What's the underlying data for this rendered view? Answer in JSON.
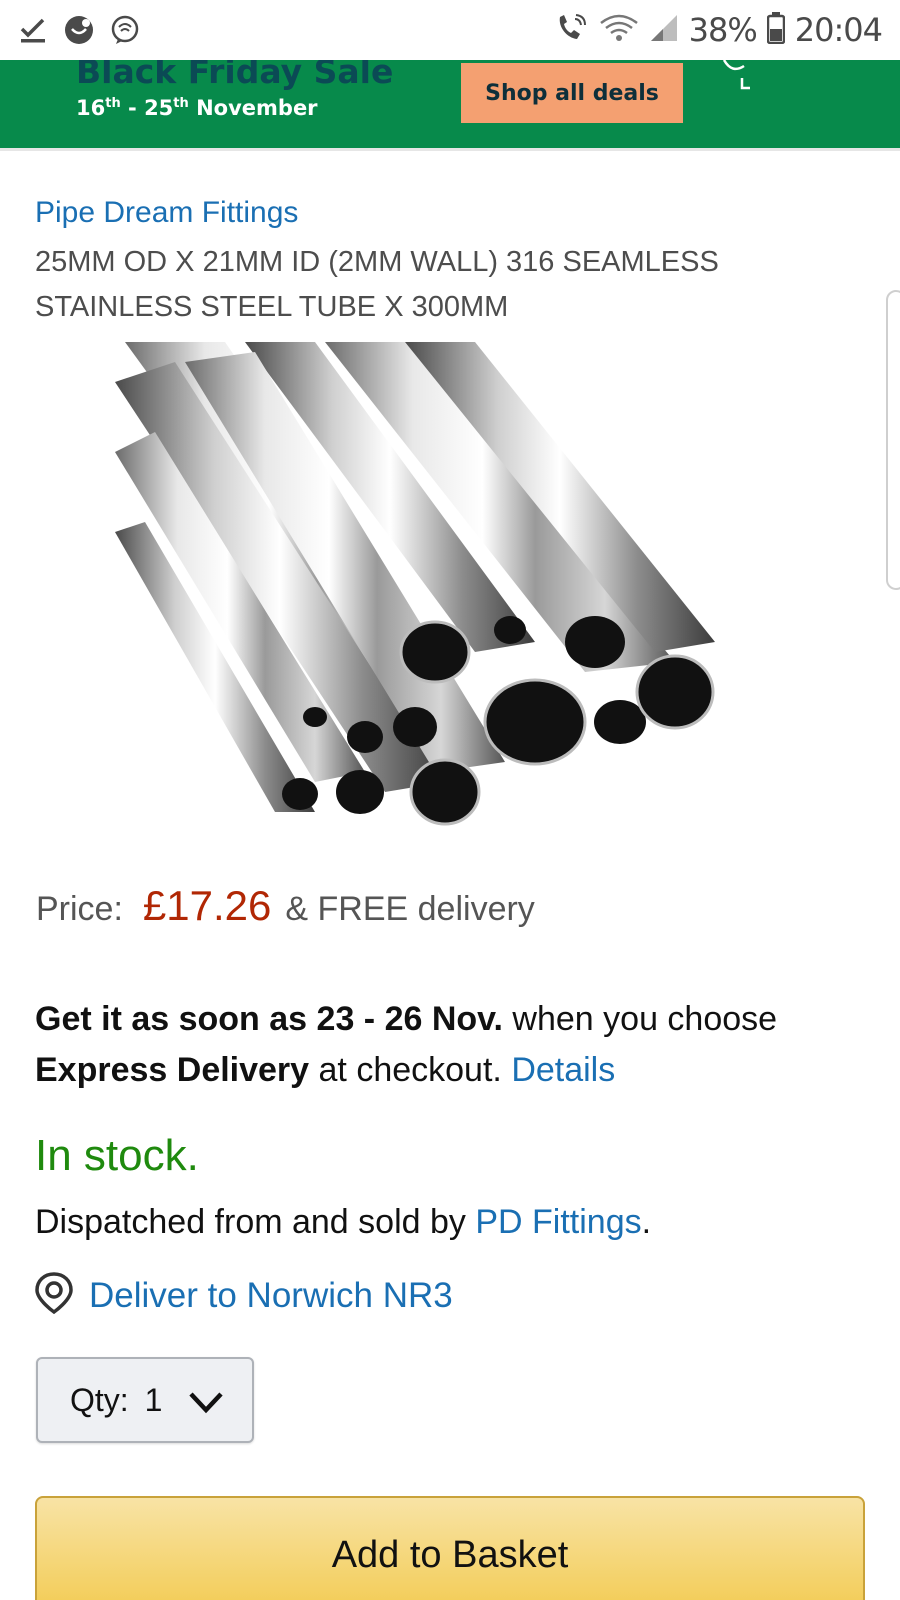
{
  "status_bar": {
    "battery": "38%",
    "time": "20:04",
    "icons": [
      "check-download-icon",
      "smiley-icon",
      "messenger-icon",
      "wifi-calling-icon",
      "wifi-icon",
      "signal-icon",
      "battery-icon"
    ]
  },
  "banner": {
    "title": "Black Friday Sale",
    "dates_start_day": "16",
    "dates_start_suffix": "th",
    "dates_sep": " - ",
    "dates_end_day": "25",
    "dates_end_suffix": "th",
    "dates_month": " November",
    "cta": "Shop all deals",
    "colors": {
      "background": "#078a4b",
      "cta": "#f4a071"
    }
  },
  "product": {
    "brand": "Pipe Dream Fittings",
    "title": "25MM OD X 21MM ID (2MM WALL) 316 SEAMLESS STAINLESS STEEL TUBE X 300MM",
    "image_alt": "stainless-steel-tubes-image",
    "price_label": "Price:",
    "price": "£17.26",
    "delivery_note": "& FREE delivery"
  },
  "delivery": {
    "bold_1": "Get it as soon as 23 - 26 Nov.",
    "text_1": " when you choose ",
    "bold_2": "Express Delivery",
    "text_2": " at checkout. ",
    "details_link": "Details"
  },
  "availability": {
    "stock": "In stock.",
    "dispatched_prefix": "Dispatched from and sold by ",
    "seller": "PD Fittings",
    "dispatched_suffix": ".",
    "deliver_to": "Deliver to Norwich NR3"
  },
  "quantity": {
    "label": "Qty:",
    "value": "1"
  },
  "add_to_basket": "Add to Basket",
  "colors": {
    "link": "#1a6fb3",
    "price": "#b12704",
    "stock": "#1f8a0e",
    "button": "#f2c94b"
  }
}
